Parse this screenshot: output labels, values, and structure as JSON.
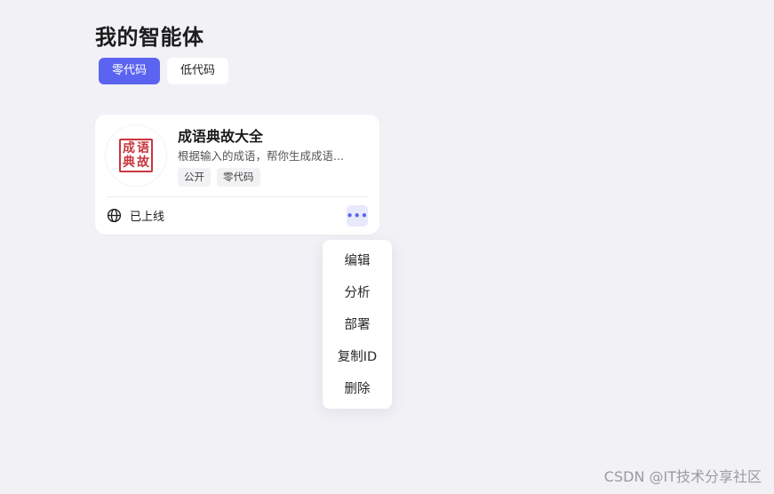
{
  "page": {
    "title": "我的智能体"
  },
  "tabs": [
    {
      "label": "零代码",
      "active": true
    },
    {
      "label": "低代码",
      "active": false
    }
  ],
  "card": {
    "seal_chars": [
      "成",
      "语",
      "典",
      "故"
    ],
    "title": "成语典故大全",
    "description": "根据输入的成语，帮你生成成语...",
    "tags": [
      "公开",
      "零代码"
    ],
    "status_icon": "globe-icon",
    "status": "已上线",
    "more_label": "•••"
  },
  "menu": {
    "items": [
      "编辑",
      "分析",
      "部署",
      "复制ID",
      "删除"
    ]
  },
  "watermark": "CSDN @IT技术分享社区",
  "colors": {
    "accent": "#5b64f0",
    "background": "#f1f1f6",
    "seal": "#c9363e"
  }
}
